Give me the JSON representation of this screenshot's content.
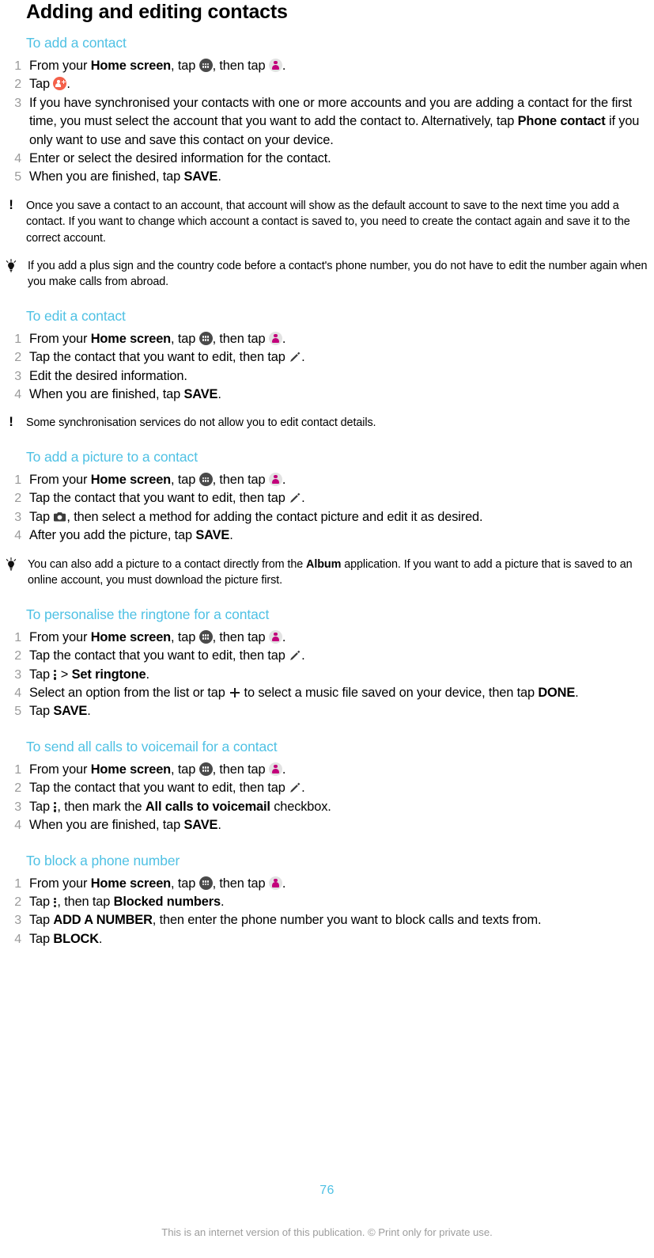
{
  "document": {
    "title": "Adding and editing contacts",
    "page_number": "76",
    "footer_note": "This is an internet version of this publication. © Print only for private use.",
    "heading_color": "#4FC1E4",
    "step_number_color": "#9A9A9A"
  },
  "sections": [
    {
      "heading": "To add a contact",
      "steps": [
        {
          "n": "1",
          "parts": [
            "From your ",
            "Home screen",
            ", tap ",
            "[appdrawer-icon]",
            ", then tap ",
            "[contacts-icon]",
            "."
          ]
        },
        {
          "n": "2",
          "parts": [
            "Tap ",
            "[add-contact-icon]",
            "."
          ]
        },
        {
          "n": "3",
          "parts": [
            "If you have synchronised your contacts with one or more accounts and you are adding a contact for the first time, you must select the account that you want to add the contact to. Alternatively, tap ",
            "Phone contact",
            " if you only want to use and save this contact on your device."
          ]
        },
        {
          "n": "4",
          "parts": [
            "Enter or select the desired information for the contact."
          ]
        },
        {
          "n": "5",
          "parts": [
            "When you are finished, tap ",
            "SAVE",
            "."
          ]
        }
      ],
      "callouts": [
        {
          "type": "note",
          "icon": "exclamation-icon",
          "text": "Once you save a contact to an account, that account will show as the default account to save to the next time you add a contact. If you want to change which account a contact is saved to, you need to create the contact again and save it to the correct account."
        },
        {
          "type": "tip",
          "icon": "lightbulb-icon",
          "text": "If you add a plus sign and the country code before a contact's phone number, you do not have to edit the number again when you make calls from abroad."
        }
      ]
    },
    {
      "heading": "To edit a contact",
      "steps": [
        {
          "n": "1",
          "parts": [
            "From your ",
            "Home screen",
            ", tap ",
            "[appdrawer-icon]",
            ", then tap ",
            "[contacts-icon]",
            "."
          ]
        },
        {
          "n": "2",
          "parts": [
            "Tap the contact that you want to edit, then tap ",
            "[pencil-icon]",
            "."
          ]
        },
        {
          "n": "3",
          "parts": [
            "Edit the desired information."
          ]
        },
        {
          "n": "4",
          "parts": [
            "When you are finished, tap ",
            "SAVE",
            "."
          ]
        }
      ],
      "callouts": [
        {
          "type": "note",
          "icon": "exclamation-icon",
          "text": "Some synchronisation services do not allow you to edit contact details."
        }
      ]
    },
    {
      "heading": "To add a picture to a contact",
      "steps": [
        {
          "n": "1",
          "parts": [
            "From your ",
            "Home screen",
            ", tap ",
            "[appdrawer-icon]",
            ", then tap ",
            "[contacts-icon]",
            "."
          ]
        },
        {
          "n": "2",
          "parts": [
            "Tap the contact that you want to edit, then tap ",
            "[pencil-icon]",
            "."
          ]
        },
        {
          "n": "3",
          "parts": [
            "Tap ",
            "[camera-icon]",
            ", then select a method for adding the contact picture and edit it as desired."
          ]
        },
        {
          "n": "4",
          "parts": [
            "After you add the picture, tap ",
            "SAVE",
            "."
          ]
        }
      ],
      "callouts": [
        {
          "type": "tip",
          "icon": "lightbulb-icon",
          "text": "You can also add a picture to a contact directly from the Album application. If you want to add a picture that is saved to an online account, you must download the picture first."
        }
      ]
    },
    {
      "heading": "To personalise the ringtone for a contact",
      "steps": [
        {
          "n": "1",
          "parts": [
            "From your ",
            "Home screen",
            ", tap ",
            "[appdrawer-icon]",
            ", then tap ",
            "[contacts-icon]",
            "."
          ]
        },
        {
          "n": "2",
          "parts": [
            "Tap the contact that you want to edit, then tap ",
            "[pencil-icon]",
            "."
          ]
        },
        {
          "n": "3",
          "parts": [
            "Tap ",
            "[dots-icon]",
            " > ",
            "Set ringtone",
            "."
          ]
        },
        {
          "n": "4",
          "parts": [
            "Select an option from the list or tap ",
            "[plus-icon]",
            " to select a music file saved on your device, then tap ",
            "DONE",
            "."
          ]
        },
        {
          "n": "5",
          "parts": [
            "Tap ",
            "SAVE",
            "."
          ]
        }
      ],
      "callouts": []
    },
    {
      "heading": "To send all calls to voicemail for a contact",
      "steps": [
        {
          "n": "1",
          "parts": [
            "From your ",
            "Home screen",
            ", tap ",
            "[appdrawer-icon]",
            ", then tap ",
            "[contacts-icon]",
            "."
          ]
        },
        {
          "n": "2",
          "parts": [
            "Tap the contact that you want to edit, then tap ",
            "[pencil-icon]",
            "."
          ]
        },
        {
          "n": "3",
          "parts": [
            "Tap ",
            "[dots-icon]",
            ", then mark the ",
            "All calls to voicemail",
            " checkbox."
          ]
        },
        {
          "n": "4",
          "parts": [
            "When you are finished, tap ",
            "SAVE",
            "."
          ]
        }
      ],
      "callouts": []
    },
    {
      "heading": "To block a phone number",
      "steps": [
        {
          "n": "1",
          "parts": [
            "From your ",
            "Home screen",
            ", tap ",
            "[appdrawer-icon]",
            ", then tap ",
            "[contacts-icon]",
            "."
          ]
        },
        {
          "n": "2",
          "parts": [
            "Tap ",
            "[dots-icon]",
            ", then tap ",
            "Blocked numbers",
            "."
          ]
        },
        {
          "n": "3",
          "parts": [
            "Tap ",
            "ADD A NUMBER",
            ", then enter the phone number you want to block calls and texts from."
          ]
        },
        {
          "n": "4",
          "parts": [
            "Tap ",
            "BLOCK",
            "."
          ]
        }
      ],
      "callouts": []
    }
  ],
  "text": {
    "s1_h": "To add a contact",
    "s1_1a": "From your ",
    "s1_1b": "Home screen",
    "s1_1c": ", tap ",
    "s1_1d": ", then tap ",
    "s1_1e": ".",
    "s1_2a": "Tap ",
    "s1_2b": ".",
    "s1_3a": "If you have synchronised your contacts with one or more accounts and you are adding a contact for the first time, you must select the account that you want to add the contact to. Alternatively, tap ",
    "s1_3b": "Phone contact",
    "s1_3c": " if you only want to use and save this contact on your device.",
    "s1_4": "Enter or select the desired information for the contact.",
    "s1_5a": "When you are finished, tap ",
    "s1_5b": "SAVE",
    "s1_5c": ".",
    "s1_note": "Once you save a contact to an account, that account will show as the default account to save to the next time you add a contact. If you want to change which account a contact is saved to, you need to create the contact again and save it to the correct account.",
    "s1_tip": "If you add a plus sign and the country code before a contact's phone number, you do not have to edit the number again when you make calls from abroad.",
    "s2_h": "To edit a contact",
    "s2_2a": "Tap the contact that you want to edit, then tap ",
    "s2_2b": ".",
    "s2_3": "Edit the desired information.",
    "s2_note": "Some synchronisation services do not allow you to edit contact details.",
    "s3_h": "To add a picture to a contact",
    "s3_3a": "Tap ",
    "s3_3b": ", then select a method for adding the contact picture and edit it as desired.",
    "s3_4a": "After you add the picture, tap ",
    "s3_4b": "SAVE",
    "s3_4c": ".",
    "s3_tipa": "You can also add a picture to a contact directly from the ",
    "s3_tipb": "Album",
    "s3_tipc": " application. If you want to add a picture that is saved to an online account, you must download the picture first.",
    "s4_h": "To personalise the ringtone for a contact",
    "s4_3a": "Tap ",
    "s4_3b": " > ",
    "s4_3c": "Set ringtone",
    "s4_3d": ".",
    "s4_4a": "Select an option from the list or tap ",
    "s4_4b": " to select a music file saved on your device, then tap ",
    "s4_4c": "DONE",
    "s4_4d": ".",
    "s4_5a": "Tap ",
    "s4_5b": "SAVE",
    "s4_5c": ".",
    "s5_h": "To send all calls to voicemail for a contact",
    "s5_3a": "Tap ",
    "s5_3b": ", then mark the ",
    "s5_3c": "All calls to voicemail",
    "s5_3d": " checkbox.",
    "s6_h": "To block a phone number",
    "s6_2a": "Tap ",
    "s6_2b": ", then tap ",
    "s6_2c": "Blocked numbers",
    "s6_2d": ".",
    "s6_3a": "Tap ",
    "s6_3b": "ADD A NUMBER",
    "s6_3c": ", then enter the phone number you want to block calls and texts from.",
    "s6_4a": "Tap ",
    "s6_4b": "BLOCK",
    "s6_4c": "."
  },
  "numbers": {
    "n1": "1",
    "n2": "2",
    "n3": "3",
    "n4": "4",
    "n5": "5"
  }
}
